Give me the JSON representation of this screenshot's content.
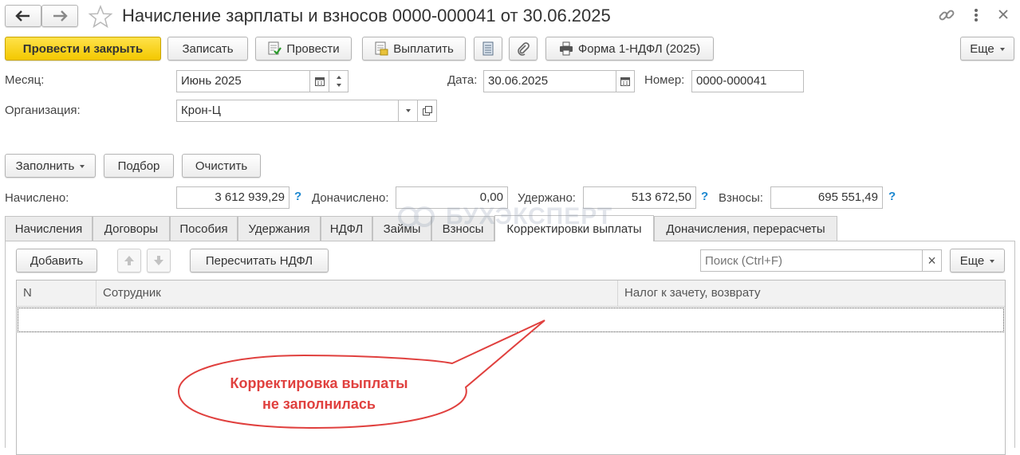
{
  "window": {
    "title": "Начисление зарплаты и взносов 0000-000041 от 30.06.2025"
  },
  "toolbar": {
    "post_and_close": "Провести и закрыть",
    "save": "Записать",
    "post": "Провести",
    "pay": "Выплатить",
    "form": "Форма 1-НДФЛ (2025)",
    "more": "Еще"
  },
  "header": {
    "month_label": "Месяц:",
    "month_value": "Июнь 2025",
    "date_label": "Дата:",
    "date_value": "30.06.2025",
    "number_label": "Номер:",
    "number_value": "0000-000041",
    "org_label": "Организация:",
    "org_value": "Крон-Ц"
  },
  "actions": {
    "fill": "Заполнить",
    "select": "Подбор",
    "clear": "Очистить"
  },
  "totals": {
    "accrued_label": "Начислено:",
    "accrued_value": "3 612 939,29",
    "additional_label": "Доначислено:",
    "additional_value": "0,00",
    "withheld_label": "Удержано:",
    "withheld_value": "513 672,50",
    "contrib_label": "Взносы:",
    "contrib_value": "695 551,49",
    "help": "?"
  },
  "tabs": [
    {
      "label": "Начисления"
    },
    {
      "label": "Договоры"
    },
    {
      "label": "Пособия"
    },
    {
      "label": "Удержания"
    },
    {
      "label": "НДФЛ"
    },
    {
      "label": "Займы"
    },
    {
      "label": "Взносы"
    },
    {
      "label": "Корректировки выплаты",
      "active": true
    },
    {
      "label": "Доначисления, перерасчеты"
    }
  ],
  "watermark": "БУХЭКСПЕРТ",
  "panel": {
    "add": "Добавить",
    "recalc": "Пересчитать НДФЛ",
    "search_placeholder": "Поиск (Ctrl+F)",
    "search_clear": "×",
    "more": "Еще"
  },
  "table": {
    "columns": [
      "N",
      "Сотрудник",
      "Налог к зачету, возврату"
    ]
  },
  "callout": {
    "line1": "Корректировка выплаты",
    "line2": "не заполнилась",
    "color": "#e0403e"
  }
}
